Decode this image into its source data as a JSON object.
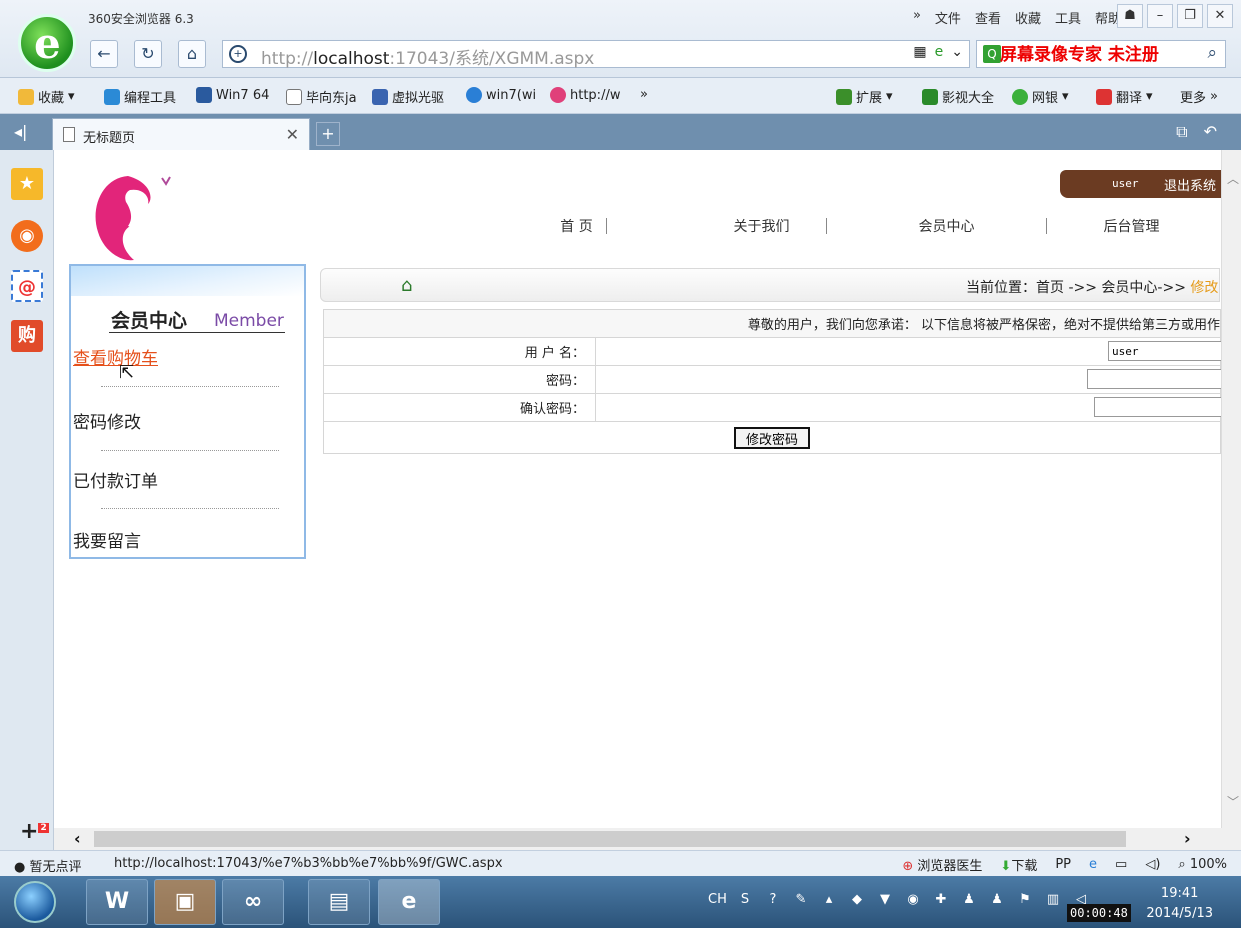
{
  "browser": {
    "app_title": "360安全浏览器 6.3",
    "menu": [
      "»",
      "文件",
      "查看",
      "收藏",
      "工具",
      "帮助"
    ],
    "window_buttons": [
      "pin-icon",
      "minimize-icon",
      "restore-icon",
      "close-icon"
    ],
    "url_prefix": "http://",
    "url_host": "localhost",
    "url_rest": ":17043/系统/XGMM.aspx",
    "watermark": "屏幕录像专家 未注册",
    "favorites": [
      "收藏",
      "编程工具",
      "Win7 64",
      "毕向东ja",
      "虚拟光驱",
      "win7(wi",
      "http://w",
      "»"
    ],
    "fav_right": [
      "扩展",
      "影视大全",
      "网银",
      "翻译",
      "更多"
    ],
    "tab_title": "无标题页"
  },
  "page": {
    "user": "user",
    "logout": "退出系统",
    "nav": [
      "首 页",
      "关于我们",
      "会员中心",
      "后台管理"
    ],
    "sidebar": {
      "title_cn": "会员中心",
      "title_en": "Member",
      "links": [
        "查看购物车",
        "密码修改",
        "已付款订单",
        "我要留言"
      ]
    },
    "breadcrumb": {
      "prefix": "当前位置：首页 ->> 会员中心->> ",
      "current": "修改"
    },
    "form": {
      "notice": "尊敬的用户，我们向您承诺： 以下信息将被严格保密，绝对不提供给第三方或用作",
      "username_label": "用 户 名：",
      "username_value": "user",
      "password_label": "密码：",
      "password_value": "",
      "confirm_label": "确认密码：",
      "confirm_value": "",
      "submit": "修改密码"
    }
  },
  "status": {
    "rating": "暂无点评",
    "hover_url": "http://localhost:17043/%e7%b3%bb%e7%bb%9f/GWC.aspx",
    "doctor": "浏览器医生",
    "download": "下载",
    "zoom": "100%"
  },
  "taskbar": {
    "time": "19:41",
    "date": "2014/5/13",
    "lang": "CH",
    "recording": "00:00:48"
  }
}
